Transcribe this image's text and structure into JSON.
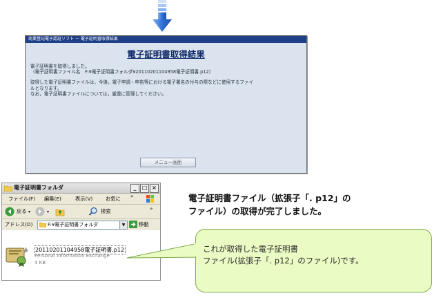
{
  "app_window": {
    "titlebar": "商業登記電子認証ソフト － 電子証明書取得結果",
    "heading": "電子証明書取得結果",
    "body": [
      "電子証明書を取得しました。",
      "（電子証明書ファイル名　F:¥電子証明書フォルダ¥20110201104958電子証明書.p12）",
      "取得した電子証明書ファイルは，今後，電子申請・申告等における電子署名の付与の際などに使用するファイ",
      "ルとなります。",
      "なお，電子証明書ファイルについては，厳重に管理してください。"
    ],
    "menu_button": "メニュー画面"
  },
  "explorer": {
    "title": "電子証明書フォルダ",
    "window_buttons": [
      "_",
      "□",
      "×"
    ],
    "menu": [
      "ファイル(F)",
      "編集(E)",
      "表示(V)",
      "お気に"
    ],
    "menu_more": "»",
    "toolbar": {
      "back": "戻る",
      "search": "検索",
      "more": "»"
    },
    "address_label": "アドレス(D)",
    "address_value": "F:¥電子証明書フォルダ",
    "go_label": "移動",
    "file": {
      "name": "20110201104958電子証明書.p12",
      "type": "Personal Information Exchange",
      "size": "4 KB"
    }
  },
  "caption": [
    "電子証明書ファイル（拡張子「. p12」の",
    "ファイル）の取得が完了しました。"
  ],
  "callout": [
    "これが取得した電子証明書",
    "ファイル(拡張子「. p12」のファイル)です。"
  ],
  "colors": {
    "arrow": "#2f6fd6",
    "app_background": "#dbe3ef",
    "titlebar": "#1f3f86",
    "callout_fill": "#ebfbc4",
    "callout_border": "#7aa94a"
  }
}
